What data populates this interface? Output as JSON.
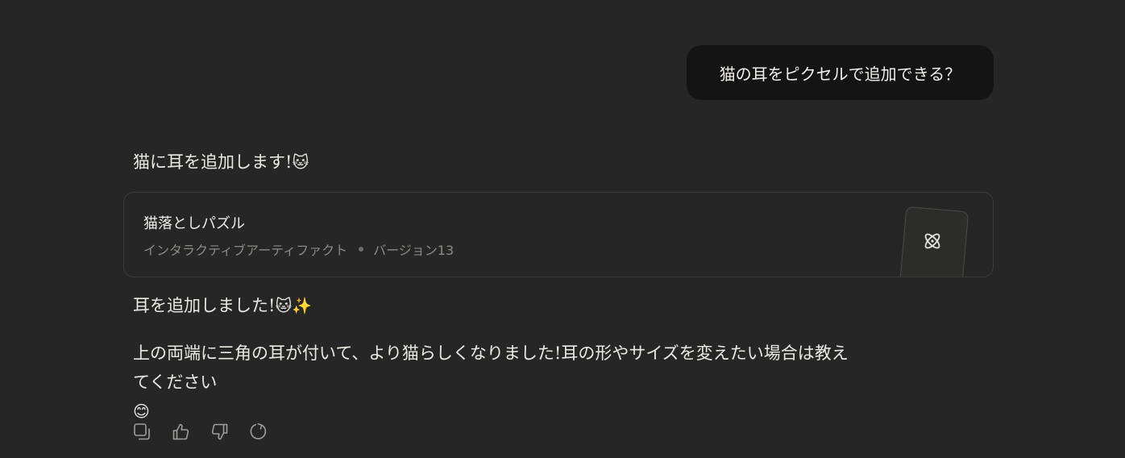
{
  "conversation": {
    "user_message": "猫の耳をピクセルで追加できる？",
    "assistant_intro": "猫に耳を追加します!",
    "assistant_intro_emoji": "🐱",
    "artifact": {
      "title": "猫落としパズル",
      "type_label": "インタラクティブアーティファクト",
      "version_label": "バージョン13",
      "icon": "atom-icon"
    },
    "assistant_added": "耳を追加しました!",
    "assistant_added_emoji": "🐱✨",
    "assistant_body_line1": "上の両端に三角の耳が付いて、より猫らしくなりました!耳の形やサイズを変えたい場合は教え",
    "assistant_body_line2": "てください",
    "assistant_body_emoji": "😊"
  },
  "actions": [
    {
      "name": "copy",
      "icon": "copy-icon"
    },
    {
      "name": "thumbs-up",
      "icon": "thumbs-up-icon"
    },
    {
      "name": "thumbs-down",
      "icon": "thumbs-down-icon"
    },
    {
      "name": "retry",
      "icon": "retry-icon"
    }
  ],
  "colors": {
    "background": "#262626",
    "user_bubble": "#141414",
    "card_border": "#3b3b3a",
    "muted_text": "#8d8b86"
  }
}
